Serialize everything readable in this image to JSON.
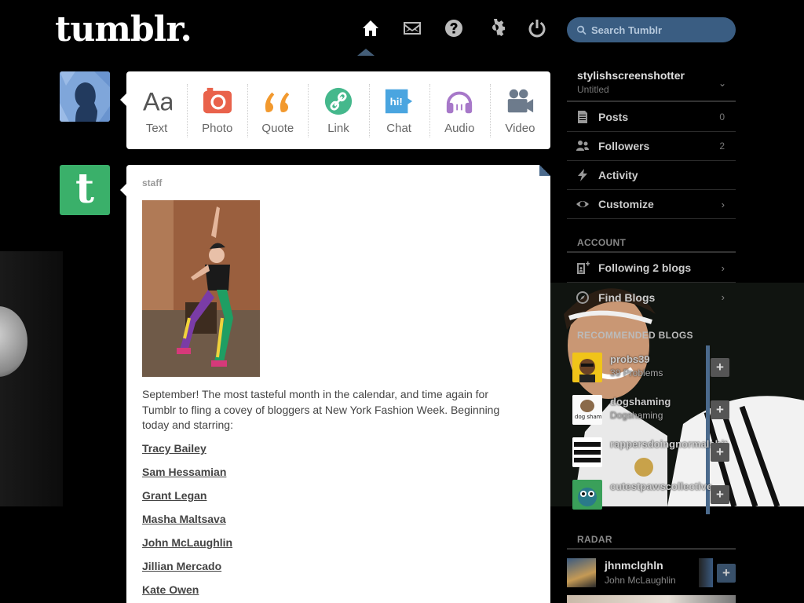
{
  "header": {
    "logo": "tumblr.",
    "nav": [
      {
        "name": "home-icon",
        "active": true
      },
      {
        "name": "mail-icon",
        "active": false
      },
      {
        "name": "help-icon",
        "active": false
      },
      {
        "name": "gear-icon",
        "active": false
      },
      {
        "name": "power-icon",
        "active": false
      }
    ],
    "search_placeholder": "Search Tumblr"
  },
  "post_types": [
    {
      "label": "Text",
      "icon": "text-icon",
      "color": "#555555"
    },
    {
      "label": "Photo",
      "icon": "camera-icon",
      "color": "#e9624b"
    },
    {
      "label": "Quote",
      "icon": "quote-icon",
      "color": "#f2992e"
    },
    {
      "label": "Link",
      "icon": "link-icon",
      "color": "#45b88c"
    },
    {
      "label": "Chat",
      "icon": "chat-icon",
      "color": "#4aa5e0"
    },
    {
      "label": "Audio",
      "icon": "headphones-icon",
      "color": "#a778c9"
    },
    {
      "label": "Video",
      "icon": "video-camera-icon",
      "color": "#6d7b8c"
    }
  ],
  "post": {
    "author": "staff",
    "body": "September! The most tasteful month in the calendar, and time again for Tumblr to fling a covey of bloggers at New York Fashion Week. Beginning today and starring:",
    "links": [
      "Tracy Bailey",
      "Sam Hessamian",
      "Grant Legan",
      "Masha Maltsava",
      "John McLaughlin",
      "Jillian Mercado",
      "Kate Owen"
    ]
  },
  "sidebar": {
    "blog_name": "stylishscreenshotter",
    "blog_sub": "Untitled",
    "items": [
      {
        "label": "Posts",
        "count": "0",
        "icon": "posts-icon"
      },
      {
        "label": "Followers",
        "count": "2",
        "icon": "followers-icon"
      },
      {
        "label": "Activity",
        "count": "",
        "icon": "lightning-icon"
      },
      {
        "label": "Customize",
        "count": "",
        "icon": "eye-icon",
        "chevron": true
      }
    ],
    "account_title": "ACCOUNT",
    "account_items": [
      {
        "label": "Following 2 blogs",
        "icon": "add-user-icon"
      },
      {
        "label": "Find Blogs",
        "icon": "compass-icon"
      }
    ],
    "recommended_title": "RECOMMENDED BLOGS",
    "recommended": [
      {
        "name": "probs39",
        "sub": "39 Problems"
      },
      {
        "name": "dogshaming",
        "sub": "Dogshaming"
      },
      {
        "name": "rappersdoingnormalshit",
        "sub": ""
      },
      {
        "name": "cutestpawscollective",
        "sub": ""
      }
    ],
    "radar_title": "RADAR",
    "radar": {
      "name": "jhnmclghln",
      "sub": "John McLaughlin"
    }
  }
}
